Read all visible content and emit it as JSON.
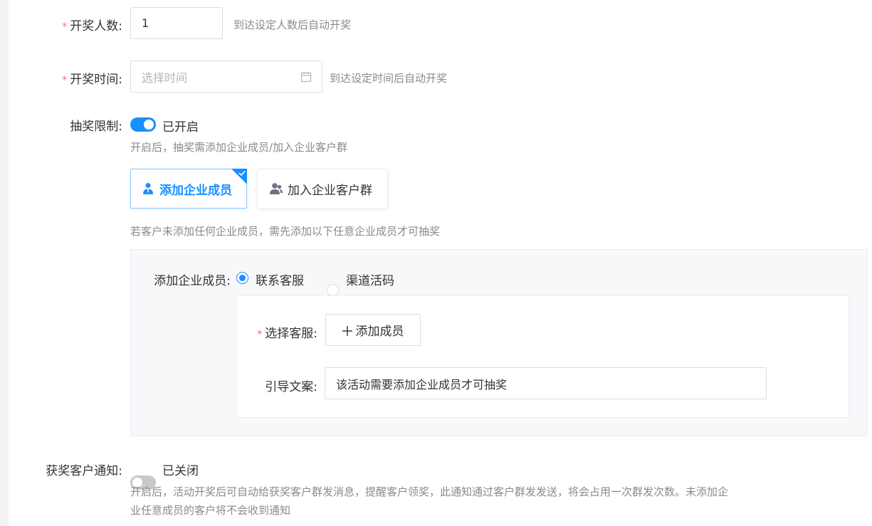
{
  "draw_count": {
    "label": "开奖人数:",
    "value": "1",
    "hint": "到达设定人数后自动开奖"
  },
  "draw_time": {
    "label": "开奖时间:",
    "placeholder": "选择时间",
    "hint": "到达设定时间后自动开奖"
  },
  "restriction": {
    "label": "抽奖限制:",
    "enabled": true,
    "status": "已开启",
    "desc": "开启后，抽奖需添加企业成员/加入企业客户群",
    "options": [
      {
        "label": "添加企业成员",
        "icon": "user-tie-icon",
        "selected": true
      },
      {
        "label": "加入企业客户群",
        "icon": "user-group-icon",
        "selected": false
      }
    ],
    "member_hint": "若客户未添加任何企业成员，需先添加以下任意企业成员才可抽奖"
  },
  "member_panel": {
    "label": "添加企业成员:",
    "radios": [
      {
        "label": "联系客服",
        "checked": true
      },
      {
        "label": "渠道活码",
        "checked": false
      }
    ],
    "service_label": "选择客服:",
    "add_member_button": "添加成员",
    "guide_label": "引导文案:",
    "guide_text": "该活动需要添加企业成员才可抽奖"
  },
  "notify": {
    "label": "获奖客户通知:",
    "enabled": false,
    "status": "已关闭",
    "desc_line1": "开启后，活动开奖后可自动给获奖客户群发消息，提醒客户领奖，此通知通过客户群发发送，将会占用一次群发次数。未添加企",
    "desc_line2": "业任意成员的客户将不会收到通知"
  },
  "colors": {
    "primary": "#1890ff",
    "required": "#f56c6c",
    "muted": "#8a8a8a"
  }
}
